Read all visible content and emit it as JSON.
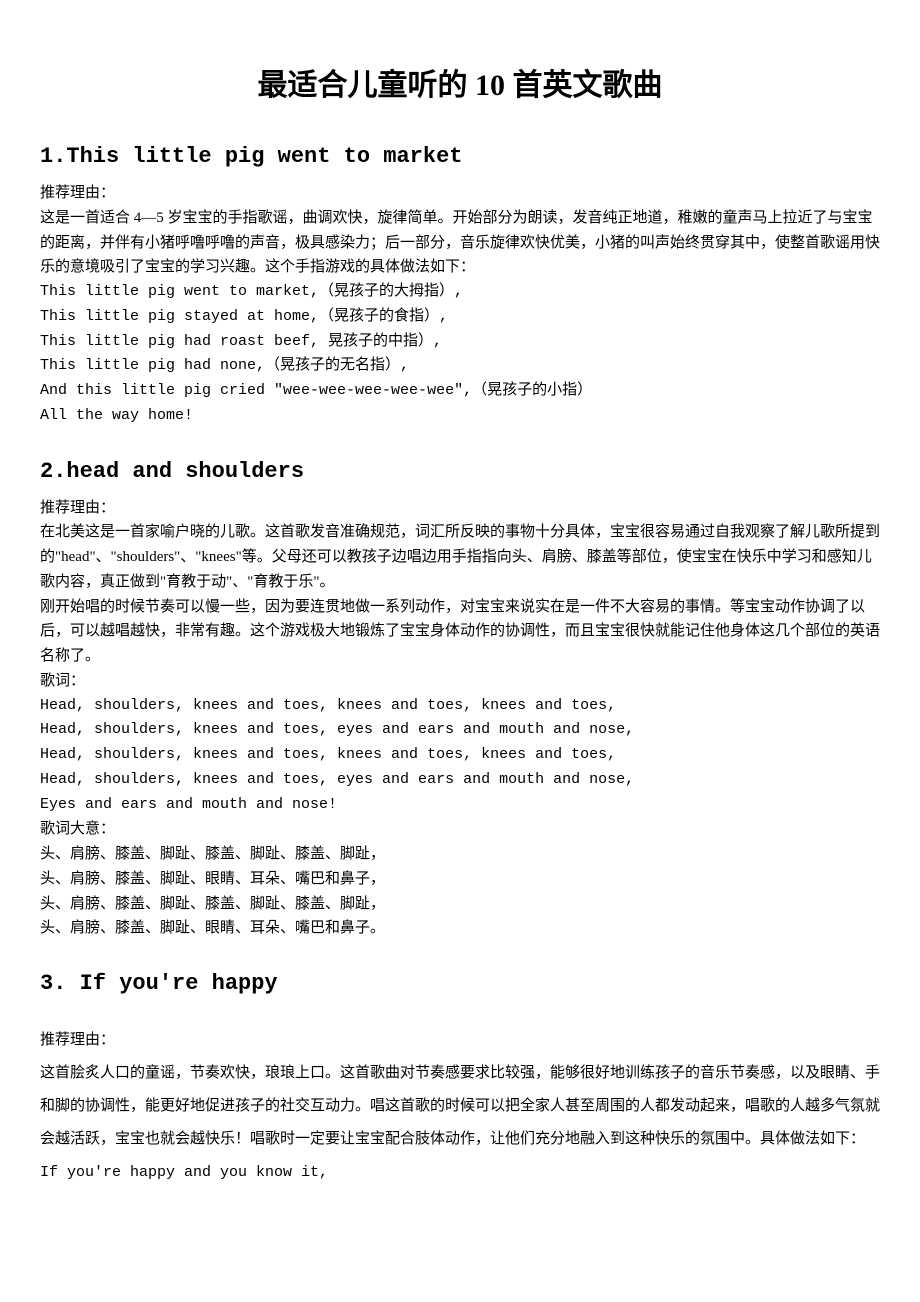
{
  "title": "最适合儿童听的 10 首英文歌曲",
  "s1": {
    "heading": "1.This little pig went to market",
    "label": "推荐理由：",
    "p1": "这是一首适合 4—5 岁宝宝的手指歌谣，曲调欢快，旋律简单。开始部分为朗读，发音纯正地道，稚嫩的童声马上拉近了与宝宝的距离，并伴有小猪呼噜呼噜的声音，极具感染力；后一部分，音乐旋律欢快优美，小猪的叫声始终贯穿其中，使整首歌谣用快乐的意境吸引了宝宝的学习兴趣。这个手指游戏的具体做法如下：",
    "l1": "This little pig went to market,（晃孩子的大拇指）,",
    "l2": "This little pig stayed at home,（晃孩子的食指）,",
    "l3": "This little pig had roast beef,  晃孩子的中指）,",
    "l4": "This little pig had none,（晃孩子的无名指）,",
    "l5": "And this little pig cried \"wee-wee-wee-wee-wee\",（晃孩子的小指）",
    "l6": "All the way home!"
  },
  "s2": {
    "heading": "2.head and shoulders",
    "label": "推荐理由：",
    "p1": "在北美这是一首家喻户晓的儿歌。这首歌发音准确规范，词汇所反映的事物十分具体，宝宝很容易通过自我观察了解儿歌所提到的\"head\"、\"shoulders\"、\"knees\"等。父母还可以教孩子边唱边用手指指向头、肩膀、膝盖等部位，使宝宝在快乐中学习和感知儿歌内容，真正做到\"育教于动\"、\"育教于乐\"。",
    "p2": "刚开始唱的时候节奏可以慢一些，因为要连贯地做一系列动作，对宝宝来说实在是一件不大容易的事情。等宝宝动作协调了以后，可以越唱越快，非常有趣。这个游戏极大地锻炼了宝宝身体动作的协调性，而且宝宝很快就能记住他身体这几个部位的英语名称了。",
    "lyricsLabel": "歌词：",
    "ly1": "Head, shoulders, knees and toes, knees and toes, knees and toes,",
    "ly2": "Head, shoulders, knees and toes, eyes and ears and mouth and nose,",
    "ly3": "Head, shoulders, knees and toes, knees and toes, knees and toes,",
    "ly4": "Head, shoulders, knees and toes, eyes and ears and mouth and nose,",
    "ly5": "Eyes and ears and mouth and nose!",
    "meaningLabel": "歌词大意：",
    "m1": "头、肩膀、膝盖、脚趾、膝盖、脚趾、膝盖、脚趾，",
    "m2": "头、肩膀、膝盖、脚趾、眼睛、耳朵、嘴巴和鼻子，",
    "m3": "头、肩膀、膝盖、脚趾、膝盖、脚趾、膝盖、脚趾，",
    "m4": "头、肩膀、膝盖、脚趾、眼睛、耳朵、嘴巴和鼻子。"
  },
  "s3": {
    "heading": "3. If you're happy",
    "label": "推荐理由：",
    "p1": "这首脍炙人口的童谣，节奏欢快，琅琅上口。这首歌曲对节奏感要求比较强，能够很好地训练孩子的音乐节奏感，以及眼睛、手和脚的协调性，能更好地促进孩子的社交互动力。唱这首歌的时候可以把全家人甚至周围的人都发动起来，唱歌的人越多气氛就会越活跃，宝宝也就会越快乐！唱歌时一定要让宝宝配合肢体动作，让他们充分地融入到这种快乐的氛围中。具体做法如下：",
    "l1": "If you're happy and you know it,"
  }
}
